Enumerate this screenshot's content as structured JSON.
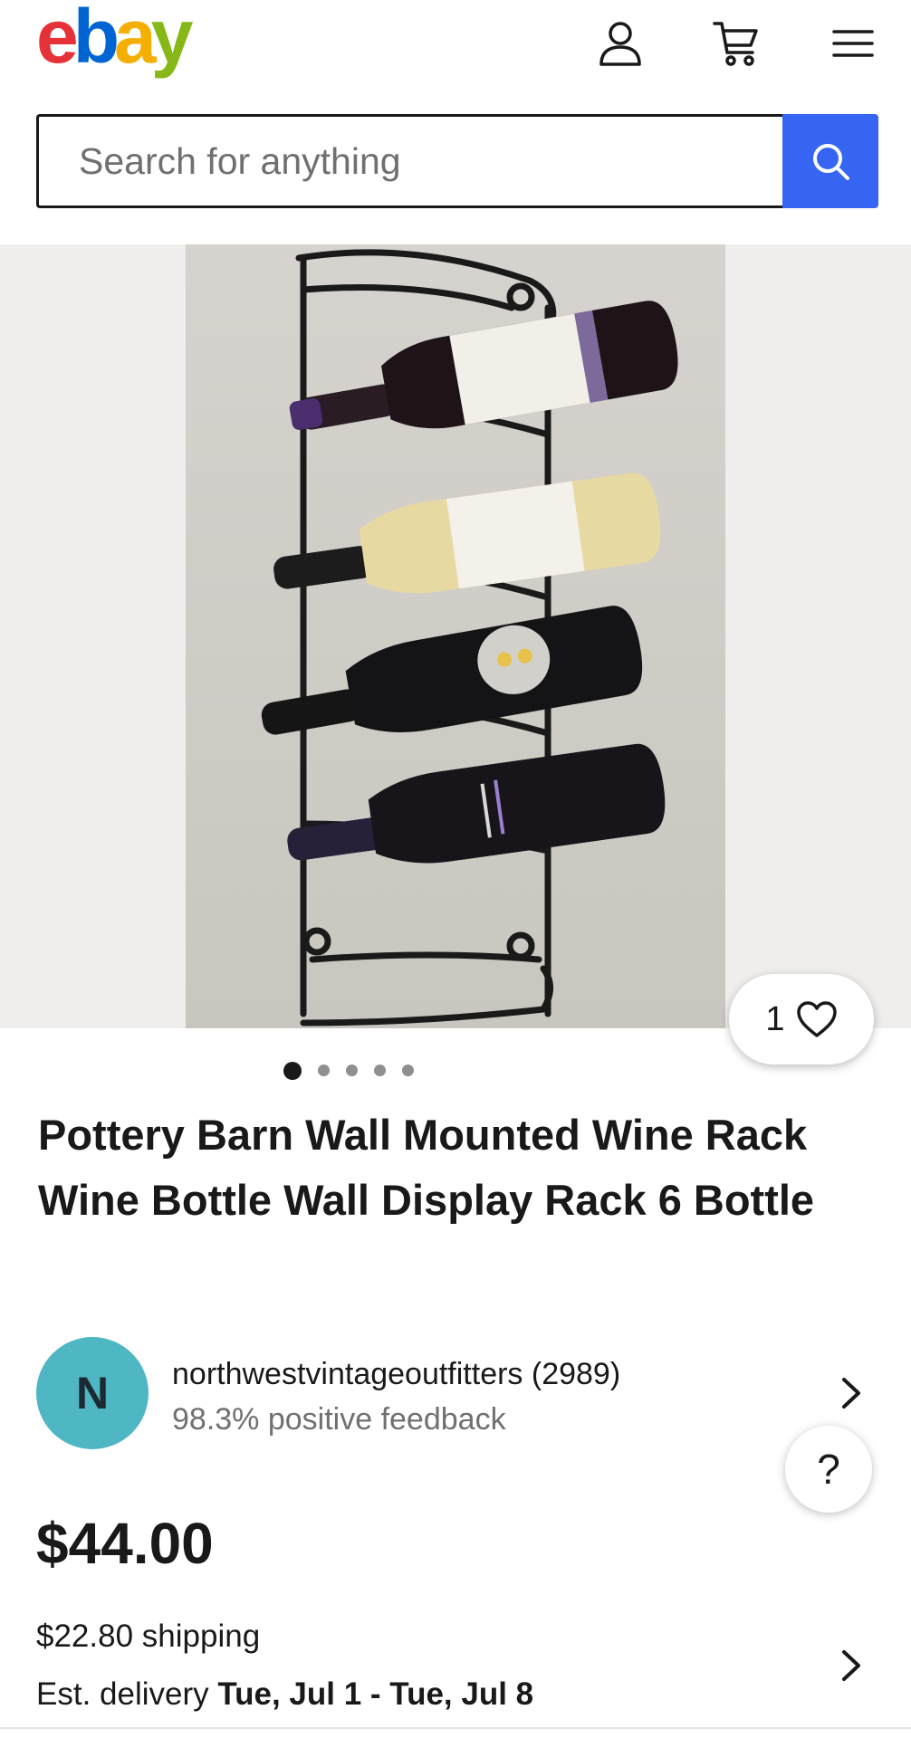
{
  "header": {
    "logo_letters": [
      "e",
      "b",
      "a",
      "y"
    ],
    "logo_colors": [
      "#e53238",
      "#0064d2",
      "#f5af02",
      "#86b817"
    ],
    "account_icon": "user-icon",
    "cart_icon": "cart-icon",
    "menu_icon": "hamburger-menu-icon"
  },
  "search": {
    "placeholder": "Search for anything",
    "button_icon": "search-icon",
    "button_color": "#3665f3"
  },
  "gallery": {
    "like_count": "1",
    "like_icon": "heart-icon",
    "image_count": 5,
    "active_index": 0
  },
  "listing": {
    "title": "Pottery Barn Wall Mounted Wine Rack Wine Bottle Wall Display Rack 6 Bottle",
    "price": "$44.00",
    "shipping": "$22.80 shipping",
    "delivery_prefix": "Est. delivery",
    "delivery_dates": "Tue, Jul 1 - Tue, Jul 8"
  },
  "seller": {
    "initial": "N",
    "avatar_color": "#4fb6c4",
    "name": "northwestvintageoutfitters (2989)",
    "feedback": "98.3% positive feedback"
  },
  "help": {
    "label": "?"
  }
}
